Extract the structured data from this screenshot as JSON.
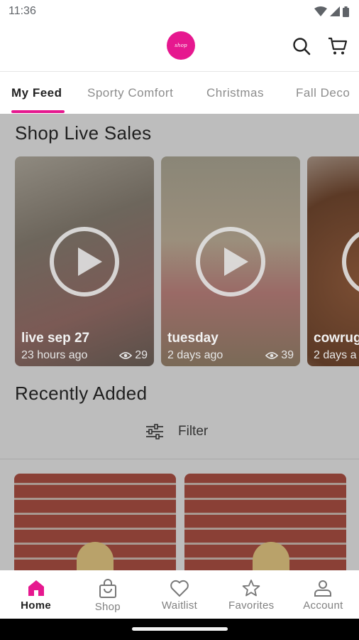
{
  "status_bar": {
    "time": "11:36"
  },
  "header": {
    "logo_icon": "brand-logo-icon",
    "search_icon": "search-icon",
    "cart_icon": "cart-icon"
  },
  "tabs": [
    {
      "label": "My Feed",
      "active": true
    },
    {
      "label": "Sporty Comfort",
      "active": false
    },
    {
      "label": "Christmas",
      "active": false
    },
    {
      "label": "Fall Deco",
      "active": false
    }
  ],
  "live_sales": {
    "title": "Shop Live Sales",
    "cards": [
      {
        "title": "live sep 27",
        "time": "23 hours ago",
        "views": "29"
      },
      {
        "title": "tuesday",
        "time": "2 days ago",
        "views": "39"
      },
      {
        "title": "cowrug",
        "time": "2 days a",
        "views": ""
      }
    ]
  },
  "recently_added": {
    "title": "Recently Added",
    "filter_label": "Filter"
  },
  "bottom_nav": [
    {
      "label": "Home",
      "icon": "home-icon",
      "active": true
    },
    {
      "label": "Shop",
      "icon": "shopping-bag-icon",
      "active": false
    },
    {
      "label": "Waitlist",
      "icon": "heart-icon",
      "active": false
    },
    {
      "label": "Favorites",
      "icon": "star-icon",
      "active": false
    },
    {
      "label": "Account",
      "icon": "person-icon",
      "active": false
    }
  ],
  "colors": {
    "accent": "#e6188f",
    "overlay": "#bdbdbd"
  }
}
